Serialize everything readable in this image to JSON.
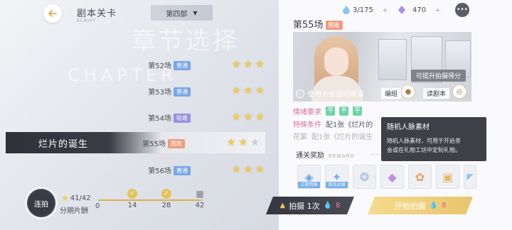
{
  "header": {
    "back_icon": "arrow-left-icon",
    "title": "剧本关卡",
    "title_sub": "SCRIPT",
    "part_select": "第四部"
  },
  "background": {
    "chapter_cn": "章节选择",
    "chapter_en": "CHAPTER"
  },
  "stages": [
    {
      "name": "第52场",
      "difficulty": "普通",
      "stars": 3
    },
    {
      "name": "第53场",
      "difficulty": "普通",
      "stars": 3
    },
    {
      "name": "第54场",
      "difficulty": "较难",
      "stars": 3
    },
    {
      "name": "第55场",
      "difficulty": "困难",
      "stars": 2,
      "selected": true,
      "chapter_title": "烂片的诞生"
    },
    {
      "name": "第56场",
      "difficulty": "普通",
      "stars": 3
    }
  ],
  "progress": {
    "lianpai_label": "连拍",
    "count": "41/42",
    "label": "分期片酬",
    "start": "0",
    "milestones": [
      "14",
      "28",
      "42"
    ],
    "fill_fraction": 0.98
  },
  "resources": {
    "water": "3/175",
    "crystal": "470"
  },
  "detail": {
    "scene_title": "第55场",
    "difficulty": "困难",
    "hint": "可提升拍摄得分",
    "auto_label": "使用卡组自动表演",
    "deck_btn": "编组",
    "read_btn": "读剧本",
    "mood_label": "情绪要求",
    "moods": [
      "平",
      "平",
      "平"
    ],
    "special_label": "特殊条件",
    "special_text": "配1张《烂片的",
    "faded_label": "花絮",
    "faded_text": "配1张《烂片的诞生",
    "reward_label": "通关奖励",
    "reward_en": "REWARD",
    "reward_tags": [
      "三星特殊",
      "首次必掉"
    ]
  },
  "tooltip": {
    "title": "随机人脉素材",
    "body_line1": "随机人脉素材，可用于开启茶",
    "body_line2": "会或在礼物工坊中定制礼物。"
  },
  "actions": {
    "shoot_once": "拍摄 1次",
    "shoot_cost": "8",
    "start_shoot": "开始拍摄",
    "start_cost": "8"
  },
  "colors": {
    "star_on": "#f2cc4f",
    "normal_tag": "#7aa6e6",
    "hard_tag": "#9a8fe0",
    "hard2_tag": "#f09b7c",
    "accent_gold": "#e9c56d"
  }
}
